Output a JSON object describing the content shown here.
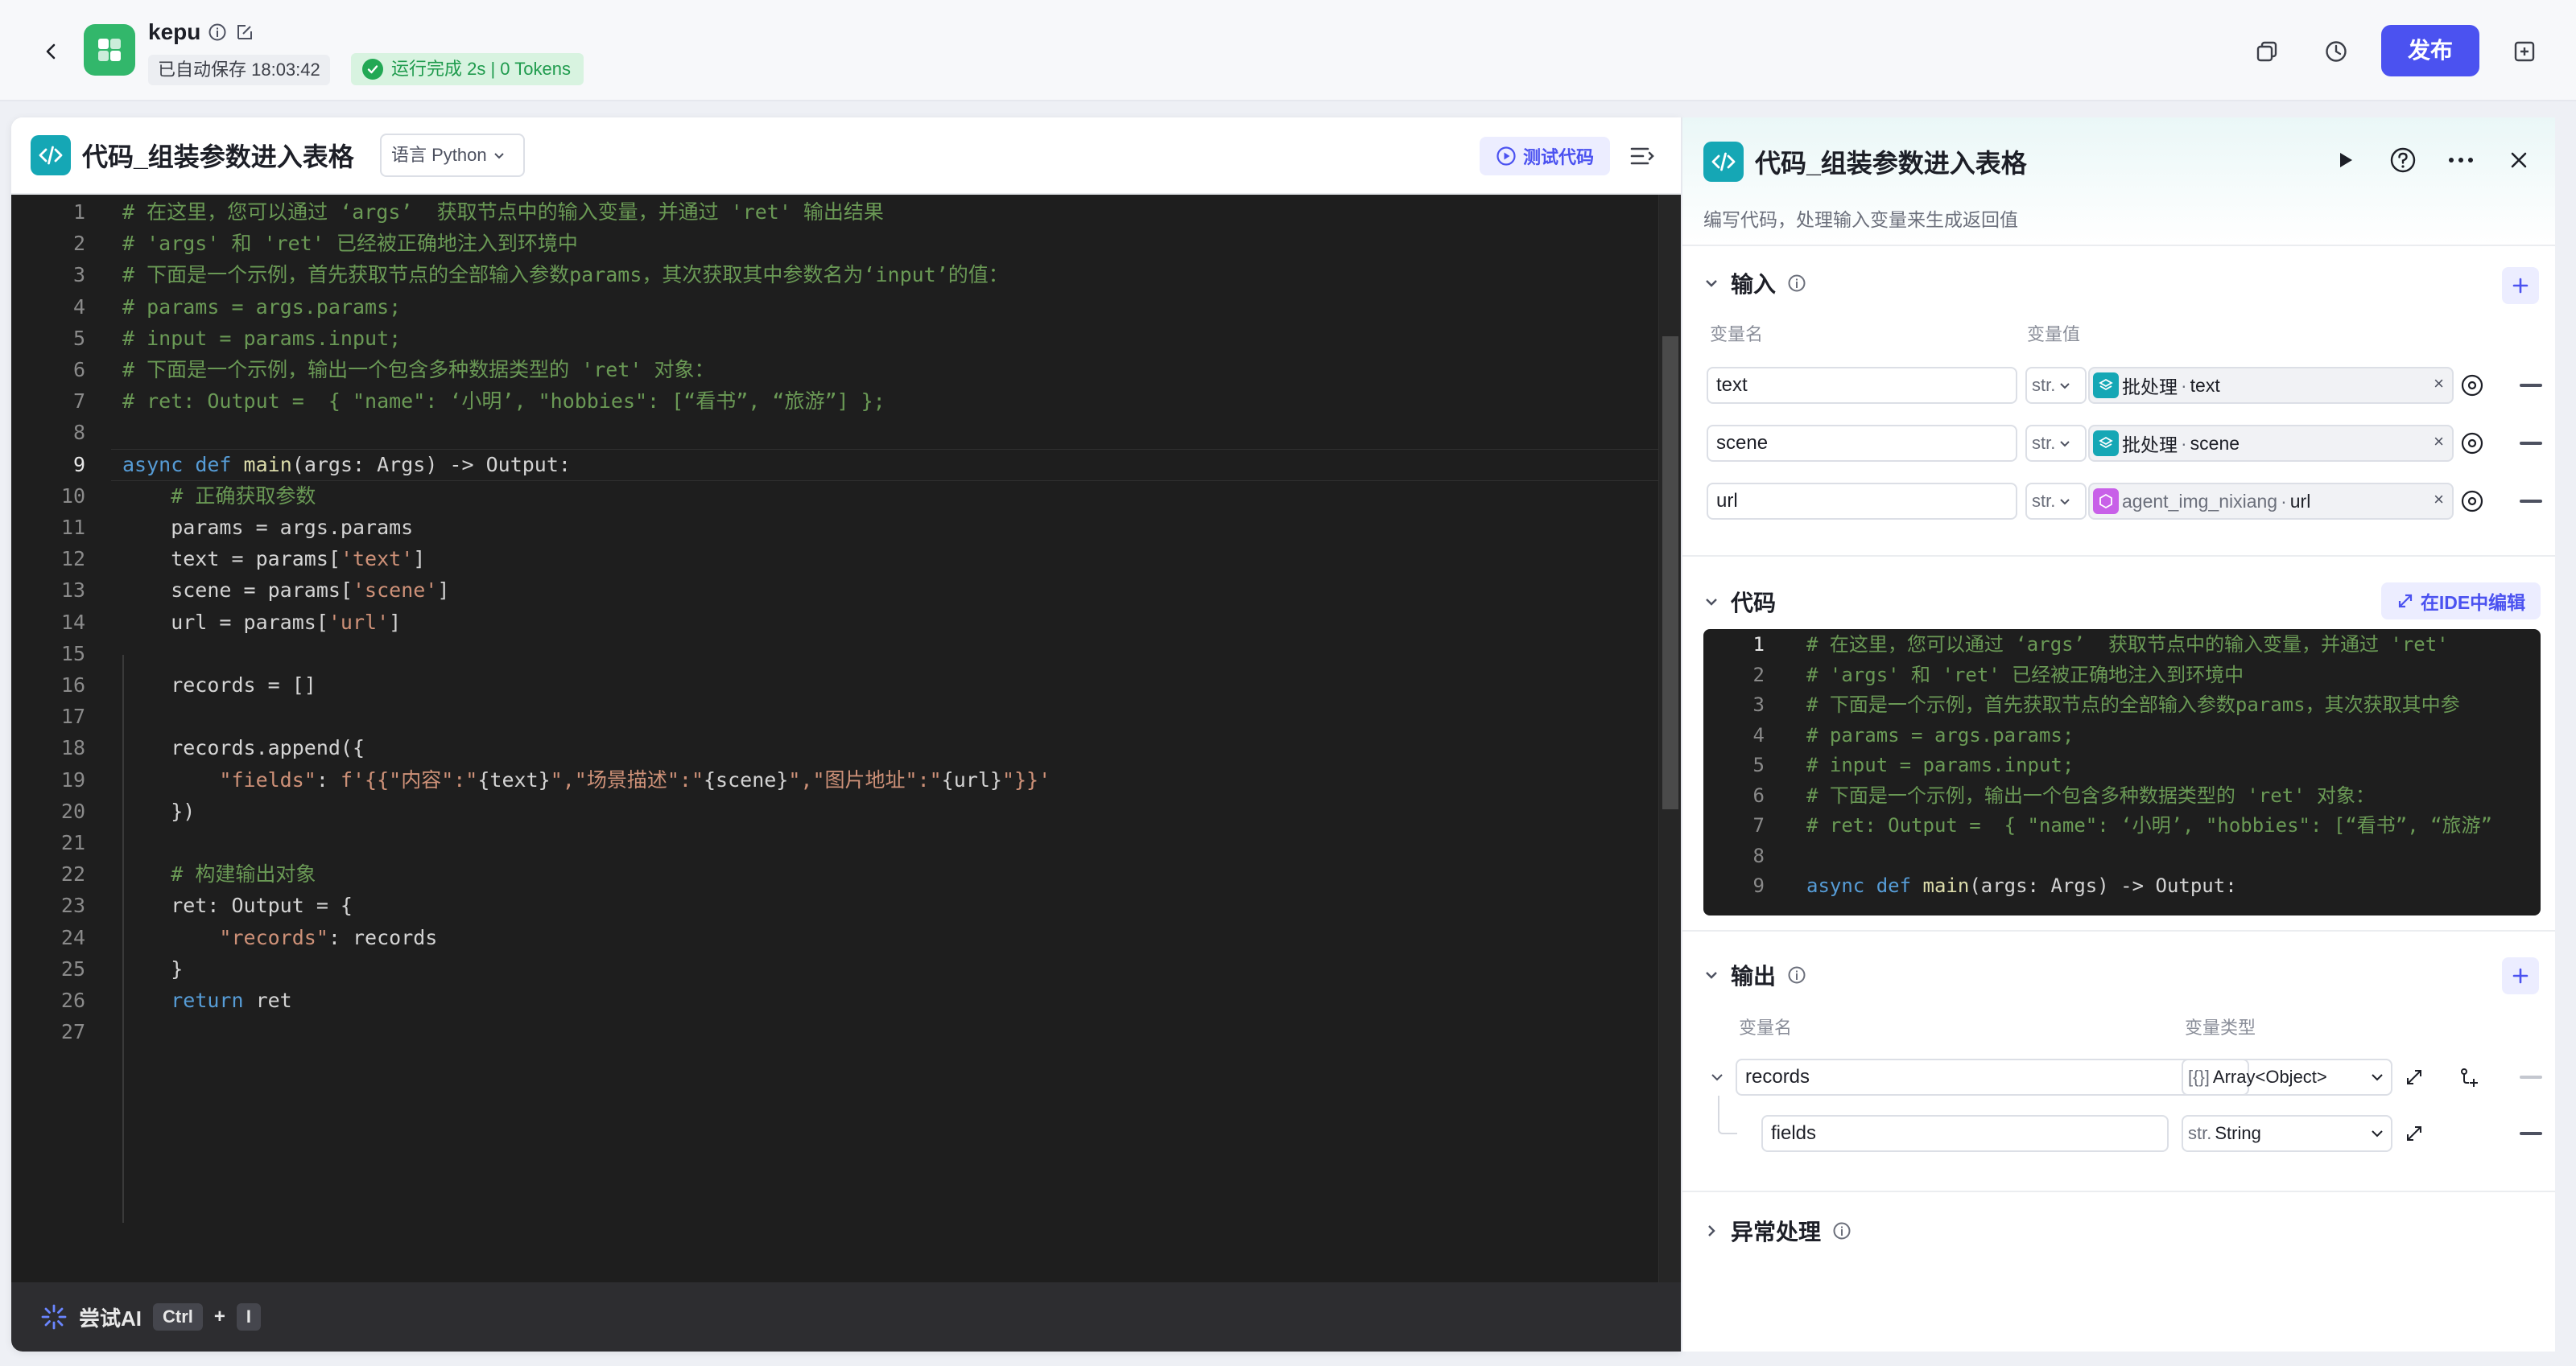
{
  "app": {
    "name": "kepu",
    "autosave": "已自动保存 18:03:42",
    "run_status": "运行完成 2s | 0 Tokens",
    "publish": "发布"
  },
  "editor": {
    "title": "代码_组装参数进入表格",
    "language": "语言 Python",
    "test_code": "测试代码",
    "lines": [
      [
        {
          "t": "# 在这里，您可以通过 ‘args’  获取节点中的输入变量，并通过 'ret' 输出结果",
          "c": "c-cmt"
        }
      ],
      [
        {
          "t": "# 'args' 和 'ret' 已经被正确地注入到环境中",
          "c": "c-cmt"
        }
      ],
      [
        {
          "t": "# 下面是一个示例，首先获取节点的全部输入参数params，其次获取其中参数名为‘input’的值：",
          "c": "c-cmt"
        }
      ],
      [
        {
          "t": "# params = args.params;",
          "c": "c-cmt"
        }
      ],
      [
        {
          "t": "# input = params.input;",
          "c": "c-cmt"
        }
      ],
      [
        {
          "t": "# 下面是一个示例，输出一个包含多种数据类型的 'ret' 对象：",
          "c": "c-cmt"
        }
      ],
      [
        {
          "t": "# ret: Output =  { \"name\": ‘小明’, \"hobbies\": [“看书”, “旅游”] };",
          "c": "c-cmt"
        }
      ],
      [],
      [
        {
          "t": "async",
          "c": "c-kw"
        },
        {
          "t": " ",
          "c": "c-pun"
        },
        {
          "t": "def",
          "c": "c-kw"
        },
        {
          "t": " ",
          "c": "c-pun"
        },
        {
          "t": "main",
          "c": "c-fn"
        },
        {
          "t": "(args: Args) -> Output:",
          "c": "c-var"
        }
      ],
      [
        {
          "t": "    ",
          "c": "c-pun"
        },
        {
          "t": "# 正确获取参数",
          "c": "c-cmt"
        }
      ],
      [
        {
          "t": "    params = args.params",
          "c": "c-var"
        }
      ],
      [
        {
          "t": "    text = params[",
          "c": "c-var"
        },
        {
          "t": "'text'",
          "c": "c-str"
        },
        {
          "t": "]",
          "c": "c-var"
        }
      ],
      [
        {
          "t": "    scene = params[",
          "c": "c-var"
        },
        {
          "t": "'scene'",
          "c": "c-str"
        },
        {
          "t": "]",
          "c": "c-var"
        }
      ],
      [
        {
          "t": "    url = params[",
          "c": "c-var"
        },
        {
          "t": "'url'",
          "c": "c-str"
        },
        {
          "t": "]",
          "c": "c-var"
        }
      ],
      [],
      [
        {
          "t": "    records = []",
          "c": "c-var"
        }
      ],
      [],
      [
        {
          "t": "    records.append({",
          "c": "c-var"
        }
      ],
      [
        {
          "t": "        ",
          "c": "c-pun"
        },
        {
          "t": "\"fields\"",
          "c": "c-str"
        },
        {
          "t": ": ",
          "c": "c-var"
        },
        {
          "t": "f'{{\"内容\":\"",
          "c": "c-str"
        },
        {
          "t": "{text}",
          "c": "c-var"
        },
        {
          "t": "\",\"场景描述\":\"",
          "c": "c-str"
        },
        {
          "t": "{scene}",
          "c": "c-var"
        },
        {
          "t": "\",\"图片地址\":\"",
          "c": "c-str"
        },
        {
          "t": "{url}",
          "c": "c-var"
        },
        {
          "t": "\"}}'",
          "c": "c-str"
        }
      ],
      [
        {
          "t": "    })",
          "c": "c-var"
        }
      ],
      [],
      [
        {
          "t": "    ",
          "c": "c-pun"
        },
        {
          "t": "# 构建输出对象",
          "c": "c-cmt"
        }
      ],
      [
        {
          "t": "    ret: Output = {",
          "c": "c-var"
        }
      ],
      [
        {
          "t": "        ",
          "c": "c-pun"
        },
        {
          "t": "\"records\"",
          "c": "c-str"
        },
        {
          "t": ": records",
          "c": "c-var"
        }
      ],
      [
        {
          "t": "    }",
          "c": "c-var"
        }
      ],
      [
        {
          "t": "    ",
          "c": "c-pun"
        },
        {
          "t": "return",
          "c": "c-kw"
        },
        {
          "t": " ret",
          "c": "c-var"
        }
      ],
      []
    ],
    "current_line": 9,
    "ai_bar": {
      "label": "尝试AI",
      "key1": "Ctrl",
      "plus": "+",
      "key2": "I"
    }
  },
  "node_panel": {
    "title": "代码_组装参数进入表格",
    "description": "编写代码，处理输入变量来生成返回值",
    "input": {
      "section": "输入",
      "col_name": "变量名",
      "col_value": "变量值",
      "rows": [
        {
          "name": "text",
          "type": "str.",
          "source": "批处理",
          "field": "text",
          "source_color": "#15a7b5"
        },
        {
          "name": "scene",
          "type": "str.",
          "source": "批处理",
          "field": "scene",
          "source_color": "#15a7b5"
        },
        {
          "name": "url",
          "type": "str.",
          "source": "agent_img_nixiang",
          "field": "url",
          "source_color": "#c860e8"
        }
      ]
    },
    "code": {
      "section": "代码",
      "ide_button": "在IDE中编辑",
      "preview_lines": [
        [
          {
            "t": "# 在这里，您可以通过 ‘args’  获取节点中的输入变量，并通过 'ret'",
            "c": "c-cmt"
          }
        ],
        [
          {
            "t": "# 'args' 和 'ret' 已经被正确地注入到环境中",
            "c": "c-cmt"
          }
        ],
        [
          {
            "t": "# 下面是一个示例，首先获取节点的全部输入参数params，其次获取其中参",
            "c": "c-cmt"
          }
        ],
        [
          {
            "t": "# params = args.params;",
            "c": "c-cmt"
          }
        ],
        [
          {
            "t": "# input = params.input;",
            "c": "c-cmt"
          }
        ],
        [
          {
            "t": "# 下面是一个示例，输出一个包含多种数据类型的 'ret' 对象：",
            "c": "c-cmt"
          }
        ],
        [
          {
            "t": "# ret: Output =  { \"name\": ‘小明’, \"hobbies\": [“看书”, “旅游”",
            "c": "c-cmt"
          }
        ],
        [],
        [
          {
            "t": "async",
            "c": "c-kw"
          },
          {
            "t": " ",
            "c": "c-pun"
          },
          {
            "t": "def",
            "c": "c-kw"
          },
          {
            "t": " ",
            "c": "c-pun"
          },
          {
            "t": "main",
            "c": "c-fn"
          },
          {
            "t": "(args: Args) -> Output:",
            "c": "c-var"
          }
        ]
      ]
    },
    "output": {
      "section": "输出",
      "col_name": "变量名",
      "col_type": "变量类型",
      "rows": [
        {
          "name": "records",
          "type": "Array<Object>",
          "type_prefix": "[{}]"
        },
        {
          "name": "fields",
          "type": "String",
          "type_prefix": "str."
        }
      ]
    },
    "exception": {
      "section": "异常处理"
    }
  },
  "colors": {
    "accent": "#4b52f0",
    "node": "#15a7b5",
    "success": "#22a854",
    "app_logo": "#32b76b"
  }
}
